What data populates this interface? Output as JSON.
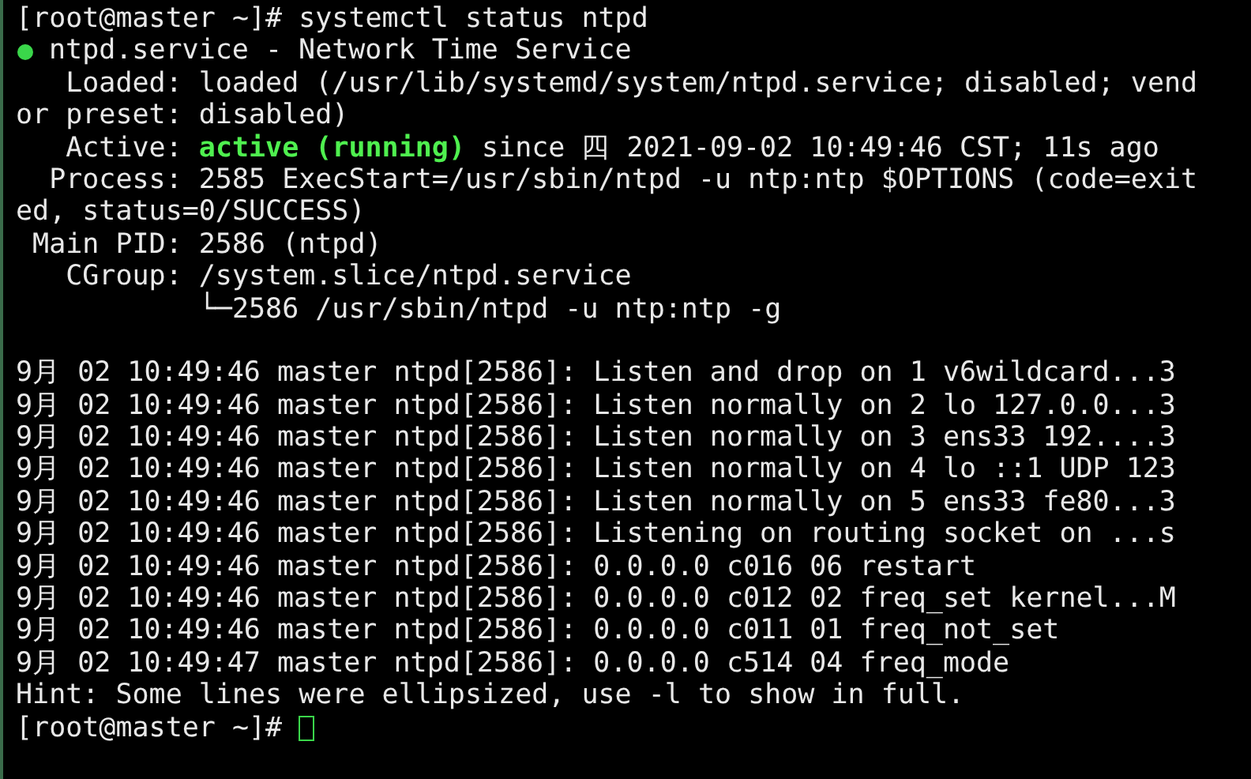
{
  "terminal": {
    "lines": [
      {
        "kind": "text",
        "text": "[root@master ~]# systemctl status ntpd"
      },
      {
        "kind": "unit",
        "text": "ntpd.service - Network Time Service"
      },
      {
        "kind": "text",
        "text": "   Loaded: loaded (/usr/lib/systemd/system/ntpd.service; disabled; vend"
      },
      {
        "kind": "text",
        "text": "or preset: disabled)"
      },
      {
        "kind": "active",
        "label": "   Active: ",
        "state": "active (running)",
        "rest": " since 四 2021-09-02 10:49:46 CST; 11s ago"
      },
      {
        "kind": "text",
        "text": "  Process: 2585 ExecStart=/usr/sbin/ntpd -u ntp:ntp $OPTIONS (code=exit"
      },
      {
        "kind": "text",
        "text": "ed, status=0/SUCCESS)"
      },
      {
        "kind": "text",
        "text": " Main PID: 2586 (ntpd)"
      },
      {
        "kind": "text",
        "text": "   CGroup: /system.slice/ntpd.service"
      },
      {
        "kind": "text",
        "text": "           └─2586 /usr/sbin/ntpd -u ntp:ntp -g"
      },
      {
        "kind": "blank"
      },
      {
        "kind": "text",
        "text": "9月 02 10:49:46 master ntpd[2586]: Listen and drop on 1 v6wildcard...3"
      },
      {
        "kind": "text",
        "text": "9月 02 10:49:46 master ntpd[2586]: Listen normally on 2 lo 127.0.0...3"
      },
      {
        "kind": "text",
        "text": "9月 02 10:49:46 master ntpd[2586]: Listen normally on 3 ens33 192....3"
      },
      {
        "kind": "text",
        "text": "9月 02 10:49:46 master ntpd[2586]: Listen normally on 4 lo ::1 UDP 123"
      },
      {
        "kind": "text",
        "text": "9月 02 10:49:46 master ntpd[2586]: Listen normally on 5 ens33 fe80...3"
      },
      {
        "kind": "text",
        "text": "9月 02 10:49:46 master ntpd[2586]: Listening on routing socket on ...s"
      },
      {
        "kind": "text",
        "text": "9月 02 10:49:46 master ntpd[2586]: 0.0.0.0 c016 06 restart"
      },
      {
        "kind": "text",
        "text": "9月 02 10:49:46 master ntpd[2586]: 0.0.0.0 c012 02 freq_set kernel...M"
      },
      {
        "kind": "text",
        "text": "9月 02 10:49:46 master ntpd[2586]: 0.0.0.0 c011 01 freq_not_set"
      },
      {
        "kind": "text",
        "text": "9月 02 10:49:47 master ntpd[2586]: 0.0.0.0 c514 04 freq_mode"
      },
      {
        "kind": "text",
        "text": "Hint: Some lines were ellipsized, use -l to show in full."
      },
      {
        "kind": "prompt",
        "text": "[root@master ~]#"
      }
    ]
  }
}
